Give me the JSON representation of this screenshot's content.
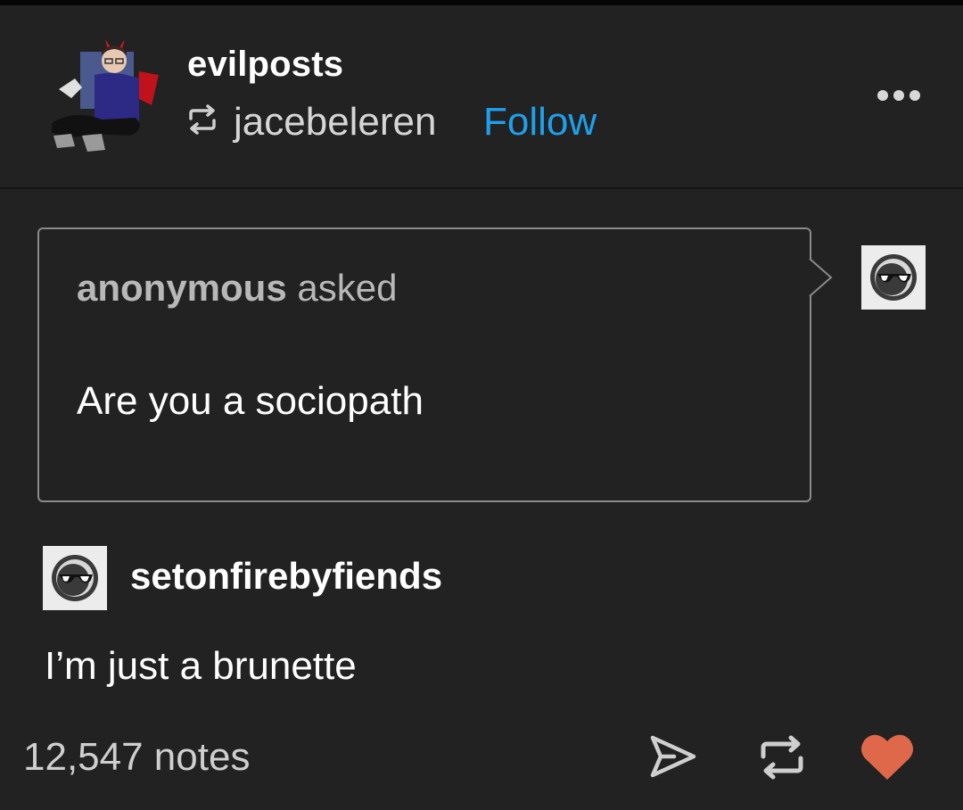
{
  "post": {
    "blog_name": "evilposts",
    "reblogged_from": "jacebeleren",
    "follow_label": "Follow"
  },
  "ask": {
    "asker": "anonymous",
    "asked_label": "asked",
    "question": "Are you a sociopath"
  },
  "answer": {
    "blog_name": "setonfirebyfiends",
    "text": "I’m just a brunette"
  },
  "footer": {
    "notes": "12,547 notes"
  },
  "colors": {
    "background": "#222222",
    "follow_link": "#1ea0ec",
    "like_heart": "#e0684a"
  },
  "icons": [
    "reblog-icon",
    "more-icon",
    "share-icon",
    "like-icon",
    "avatar"
  ]
}
